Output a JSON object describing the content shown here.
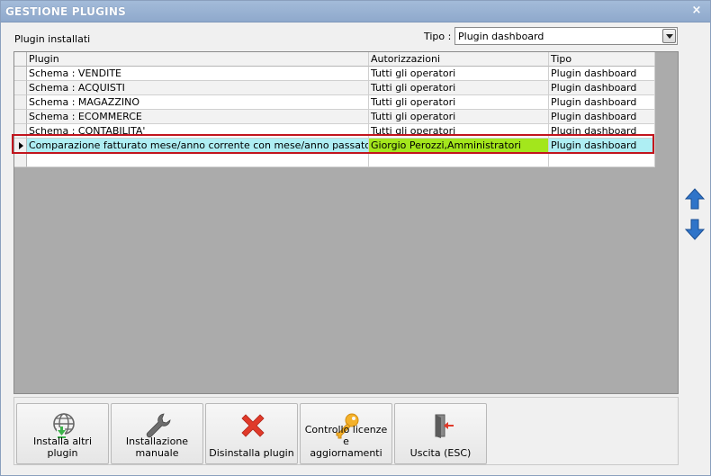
{
  "window": {
    "title": "GESTIONE PLUGINS",
    "close_glyph": "×"
  },
  "labels": {
    "installed": "Plugin installati",
    "tipo": "Tipo :"
  },
  "filter": {
    "selected": "Plugin dashboard"
  },
  "grid": {
    "columns": [
      "Plugin",
      "Autorizzazioni",
      "Tipo"
    ],
    "rows": [
      [
        "Schema : VENDITE",
        "Tutti gli operatori",
        "Plugin dashboard"
      ],
      [
        "Schema : ACQUISTI",
        "Tutti gli operatori",
        "Plugin dashboard"
      ],
      [
        "Schema : MAGAZZINO",
        "Tutti gli operatori",
        "Plugin dashboard"
      ],
      [
        "Schema : ECOMMERCE",
        "Tutti gli operatori",
        "Plugin dashboard"
      ],
      [
        "Schema : CONTABILITA'",
        "Tutti gli operatori",
        "Plugin dashboard"
      ],
      [
        "Comparazione fatturato mese/anno corrente con mese/anno passato",
        "Giorgio Perozzi,Amministratori",
        "Plugin dashboard"
      ]
    ]
  },
  "colors": {
    "selected_row": "#aeeef3",
    "selected_auth": "#a3e61c",
    "highlight_border": "#c2141d",
    "arrow_blue": "#2f74c9"
  },
  "toolbar": {
    "install_label": "Installa altri plugin",
    "manual_label_1": "Installazione",
    "manual_label_2": "manuale",
    "uninstall_label": "Disinstalla plugin",
    "license_label_1": "Controllo licenze e",
    "license_label_2": "aggiornamenti",
    "exit_label": "Uscita (ESC)"
  }
}
